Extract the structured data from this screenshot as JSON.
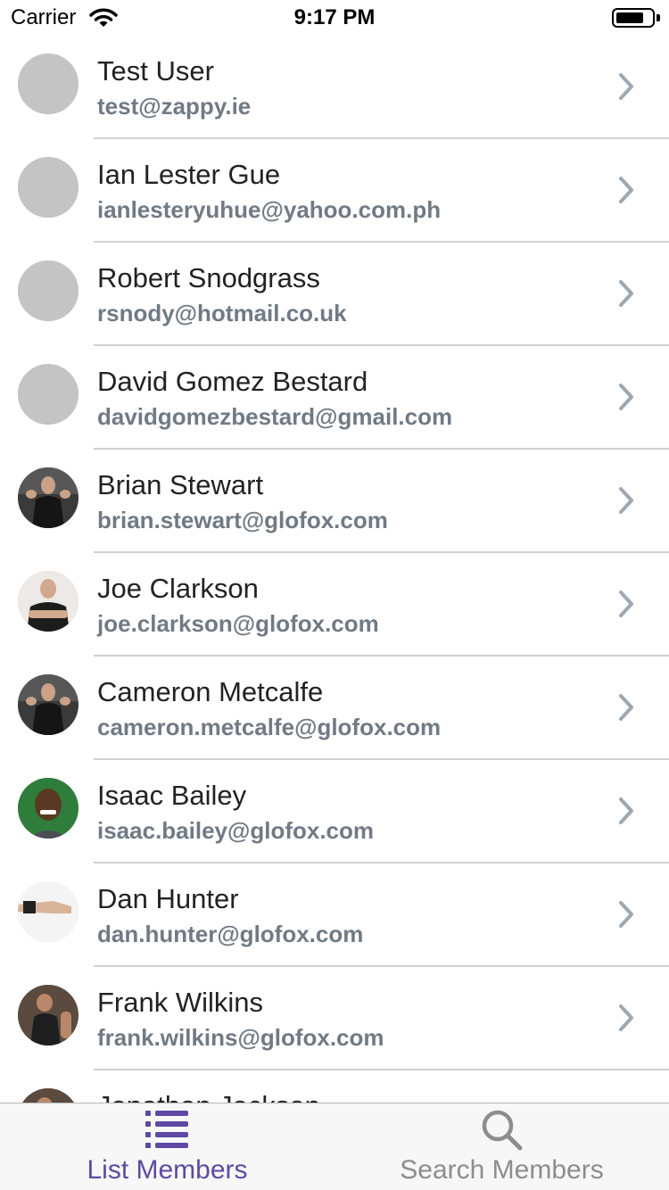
{
  "status_bar": {
    "carrier": "Carrier",
    "time": "9:17 PM",
    "battery_level": 0.8
  },
  "members": [
    {
      "name": "Test User",
      "email": "test@zappy.ie",
      "avatar": "placeholder"
    },
    {
      "name": "Ian Lester Gue",
      "email": "ianlesteryuhue@yahoo.com.ph",
      "avatar": "placeholder"
    },
    {
      "name": "Robert Snodgrass",
      "email": "rsnody@hotmail.co.uk",
      "avatar": "placeholder"
    },
    {
      "name": "David Gomez Bestard",
      "email": "davidgomezbestard@gmail.com",
      "avatar": "placeholder"
    },
    {
      "name": "Brian Stewart",
      "email": "brian.stewart@glofox.com",
      "avatar": "photo-dark"
    },
    {
      "name": "Joe Clarkson",
      "email": "joe.clarkson@glofox.com",
      "avatar": "photo-light"
    },
    {
      "name": "Cameron Metcalfe",
      "email": "cameron.metcalfe@glofox.com",
      "avatar": "photo-dark"
    },
    {
      "name": "Isaac Bailey",
      "email": "isaac.bailey@glofox.com",
      "avatar": "photo-green"
    },
    {
      "name": "Dan Hunter",
      "email": "dan.hunter@glofox.com",
      "avatar": "photo-white"
    },
    {
      "name": "Frank Wilkins",
      "email": "frank.wilkins@glofox.com",
      "avatar": "photo-gym"
    },
    {
      "name": "Jonathan Jackson",
      "email": "",
      "avatar": "photo-gym"
    }
  ],
  "tab_bar": {
    "list_members": {
      "label": "List Members",
      "icon": "list-icon",
      "active": true
    },
    "search_members": {
      "label": "Search Members",
      "icon": "search-icon",
      "active": false
    }
  },
  "colors": {
    "accent": "#5e4aa3",
    "inactive": "#8d8d8d",
    "email": "#717a84",
    "chevron": "#9ea8b3",
    "placeholder_avatar": "#c4c4c4"
  }
}
